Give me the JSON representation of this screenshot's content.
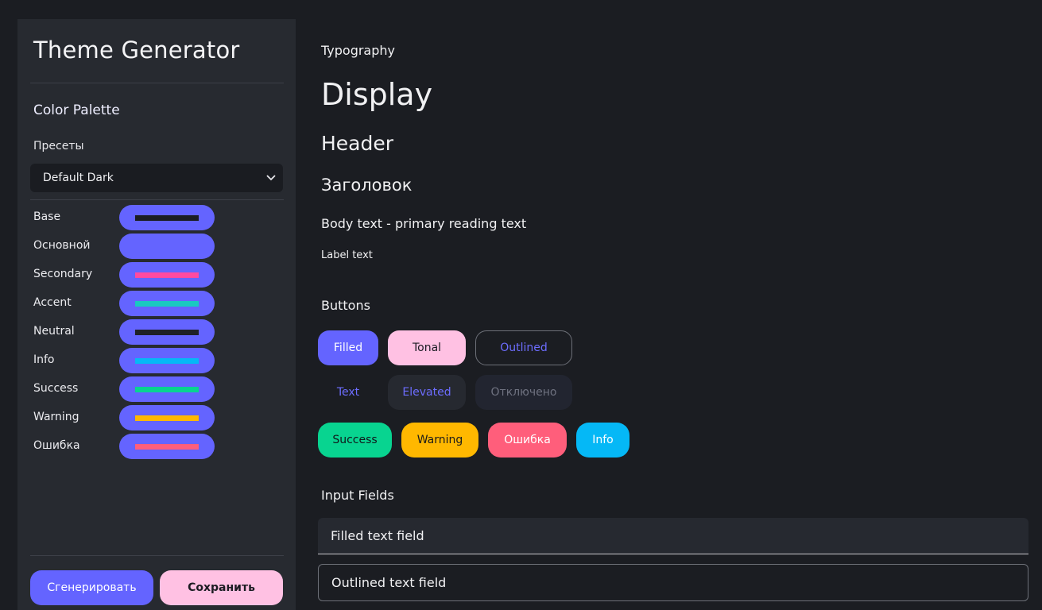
{
  "sidebar": {
    "title": "Theme Generator",
    "palette_heading": "Color Palette",
    "presets_label": "Пресеты",
    "preset_selected": "Default Dark",
    "colors": [
      {
        "label": "Base",
        "bar_color": "#1b1d22"
      },
      {
        "label": "Основной",
        "bar_color": "#6464ff"
      },
      {
        "label": "Secondary",
        "bar_color": "#ff4aa0"
      },
      {
        "label": "Accent",
        "bar_color": "#19c9c0"
      },
      {
        "label": "Neutral",
        "bar_color": "#1f2128"
      },
      {
        "label": "Info",
        "bar_color": "#05b8f6"
      },
      {
        "label": "Success",
        "bar_color": "#08d490"
      },
      {
        "label": "Warning",
        "bar_color": "#ffb800"
      },
      {
        "label": "Ошибка",
        "bar_color": "#ff5e7b"
      }
    ],
    "generate_label": "Сгенерировать",
    "save_label": "Сохранить"
  },
  "main": {
    "typography_heading": "Typography",
    "display_text": "Display",
    "header_text": "Header",
    "title_text": "Заголовок",
    "body_text": "Body text - primary reading text",
    "label_text": "Label text",
    "buttons_heading": "Buttons",
    "buttons": {
      "filled": "Filled",
      "tonal": "Tonal",
      "outlined": "Outlined",
      "text": "Text",
      "elevated": "Elevated",
      "disabled": "Отключено",
      "success": "Success",
      "warning": "Warning",
      "error": "Ошибка",
      "info": "Info"
    },
    "inputs_heading": "Input Fields",
    "inputs": {
      "filled": "Filled text field",
      "outlined": "Outlined text field"
    }
  },
  "colors": {
    "background": "#1b1d22",
    "sidebar": "#272a30",
    "primary": "#6464ff",
    "secondary_tonal": "#ffc1e3"
  }
}
